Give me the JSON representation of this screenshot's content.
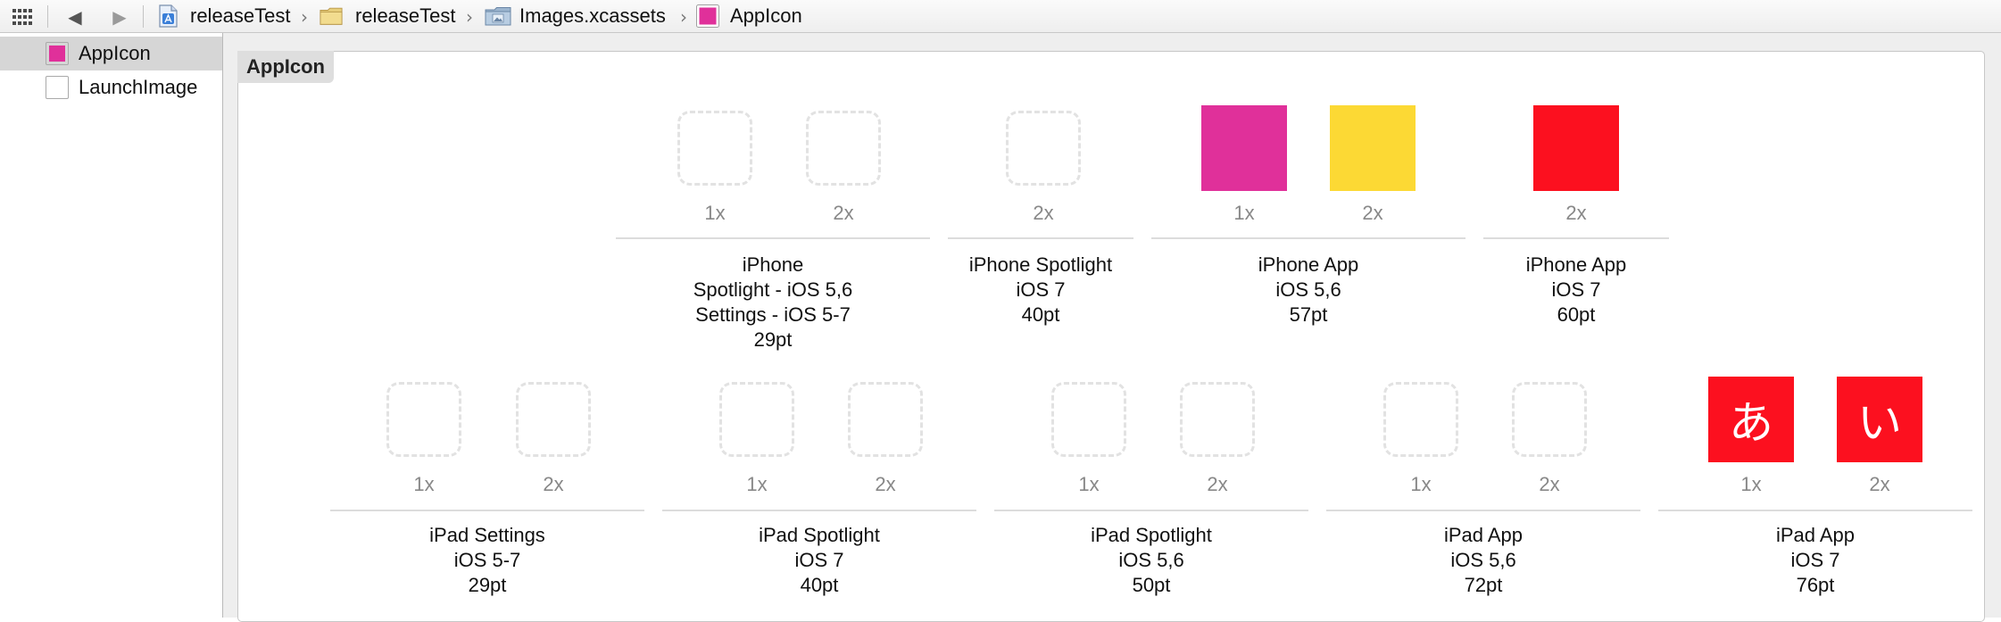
{
  "jumpbar": {
    "crumbs": [
      "releaseTest",
      "releaseTest",
      "Images.xcassets",
      "AppIcon"
    ]
  },
  "sidebar": {
    "items": [
      {
        "label": "AppIcon",
        "icon": "appicon-swatch-icon",
        "selected": true
      },
      {
        "label": "LaunchImage",
        "icon": "launchimage-swatch-icon",
        "selected": false
      }
    ]
  },
  "panel": {
    "title": "AppIcon",
    "groups": [
      {
        "lines": [
          "iPhone",
          "Spotlight - iOS 5,6",
          "Settings - iOS 5-7",
          "29pt"
        ],
        "slots": [
          {
            "scale": "1x",
            "filled": false
          },
          {
            "scale": "2x",
            "filled": false
          }
        ]
      },
      {
        "lines": [
          "iPhone Spotlight",
          "iOS 7",
          "40pt"
        ],
        "slots": [
          {
            "scale": "2x",
            "filled": false
          }
        ]
      },
      {
        "lines": [
          "iPhone App",
          "iOS 5,6",
          "57pt"
        ],
        "slots": [
          {
            "scale": "1x",
            "filled": true,
            "color": "#e0309a",
            "glyph": ""
          },
          {
            "scale": "2x",
            "filled": true,
            "color": "#fcd934",
            "glyph": ""
          }
        ]
      },
      {
        "lines": [
          "iPhone App",
          "iOS 7",
          "60pt"
        ],
        "slots": [
          {
            "scale": "2x",
            "filled": true,
            "color": "#fc101f",
            "glyph": ""
          }
        ]
      },
      {
        "lines": [
          "iPad Settings",
          "iOS 5-7",
          "29pt"
        ],
        "slots": [
          {
            "scale": "1x",
            "filled": false
          },
          {
            "scale": "2x",
            "filled": false
          }
        ]
      },
      {
        "lines": [
          "iPad Spotlight",
          "iOS 7",
          "40pt"
        ],
        "slots": [
          {
            "scale": "1x",
            "filled": false
          },
          {
            "scale": "2x",
            "filled": false
          }
        ]
      },
      {
        "lines": [
          "iPad Spotlight",
          "iOS 5,6",
          "50pt"
        ],
        "slots": [
          {
            "scale": "1x",
            "filled": false
          },
          {
            "scale": "2x",
            "filled": false
          }
        ]
      },
      {
        "lines": [
          "iPad App",
          "iOS 5,6",
          "72pt"
        ],
        "slots": [
          {
            "scale": "1x",
            "filled": false
          },
          {
            "scale": "2x",
            "filled": false
          }
        ]
      },
      {
        "lines": [
          "iPad App",
          "iOS 7",
          "76pt"
        ],
        "slots": [
          {
            "scale": "1x",
            "filled": true,
            "color": "#fc101f",
            "glyph": "あ"
          },
          {
            "scale": "2x",
            "filled": true,
            "color": "#fc101f",
            "glyph": "い"
          }
        ]
      }
    ]
  },
  "colors": {
    "appicon_swatch": "#e0309a",
    "selection": "#d6d6d6"
  }
}
